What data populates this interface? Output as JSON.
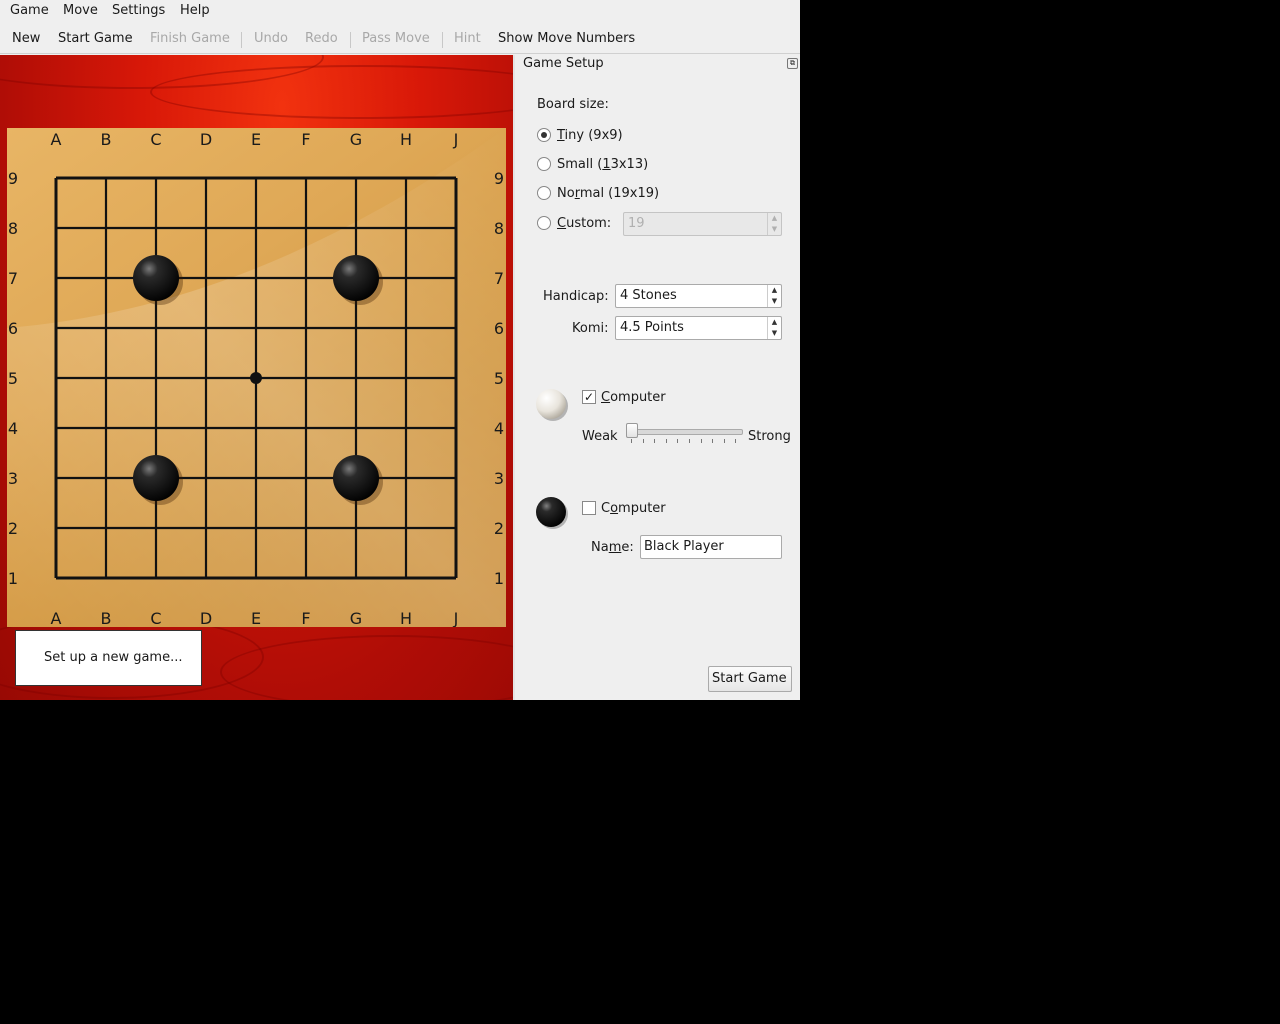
{
  "menubar": {
    "game": "Game",
    "move": "Move",
    "settings": "Settings",
    "help": "Help"
  },
  "toolbar": {
    "new": "New",
    "start_game": "Start Game",
    "finish_game": "Finish Game",
    "undo": "Undo",
    "redo": "Redo",
    "pass_move": "Pass Move",
    "hint": "Hint",
    "show_move_numbers": "Show Move Numbers"
  },
  "board": {
    "size": 9,
    "columns": [
      "A",
      "B",
      "C",
      "D",
      "E",
      "F",
      "G",
      "H",
      "J"
    ],
    "rows": [
      "9",
      "8",
      "7",
      "6",
      "5",
      "4",
      "3",
      "2",
      "1"
    ],
    "star_point": "E5",
    "stones": [
      {
        "color": "black",
        "point": "C7"
      },
      {
        "color": "black",
        "point": "G7"
      },
      {
        "color": "black",
        "point": "C3"
      },
      {
        "color": "black",
        "point": "G3"
      }
    ]
  },
  "status": {
    "text": "Set up a new game..."
  },
  "setup": {
    "title": "Game Setup",
    "board_size_label": "Board size:",
    "sizes": [
      {
        "label": "Tiny (9x9)",
        "selected": true
      },
      {
        "label": "Small (13x13)",
        "selected": false
      },
      {
        "label": "Normal (19x19)",
        "selected": false
      }
    ],
    "custom_label": "Custom:",
    "custom_value": "19",
    "handicap_label": "Handicap:",
    "handicap_value": "4 Stones",
    "komi_label": "Komi:",
    "komi_value": "4.5 Points",
    "white": {
      "computer_label": "Computer",
      "computer_checked": true,
      "check_mark": "✓",
      "weak_label": "Weak",
      "strong_label": "Strong",
      "strength": 0
    },
    "black": {
      "computer_label": "Computer",
      "computer_checked": false,
      "name_label": "Name:",
      "name_value": "Black Player"
    },
    "start_button": "Start Game"
  }
}
